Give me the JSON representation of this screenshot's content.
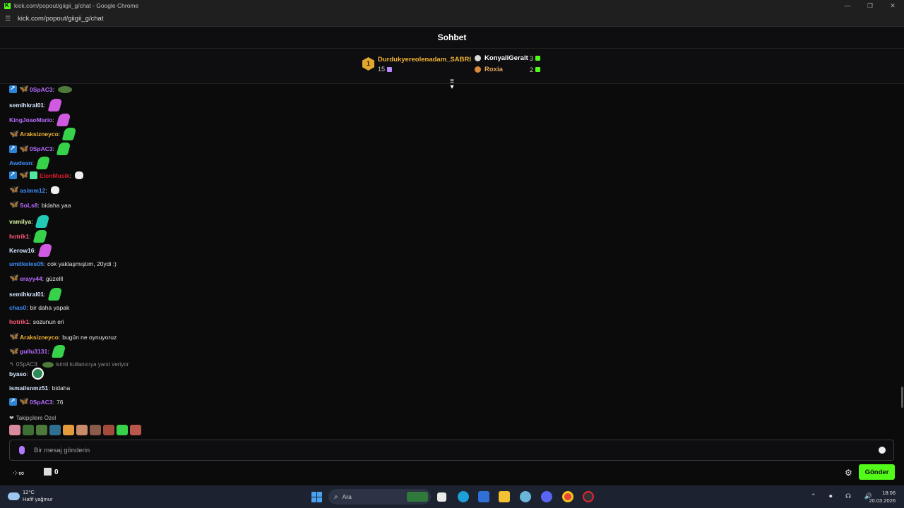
{
  "window": {
    "title": "kick.com/popout/giigii_g/chat - Google Chrome",
    "url": "kick.com/popout/giigii_g/chat"
  },
  "chat_header": {
    "title": "Sohbet"
  },
  "leaderboard": {
    "first": {
      "rank": "1",
      "name": "Durdukyereolenadam_SABRI",
      "count": "15"
    },
    "second": {
      "name": "KonyaliGeralt",
      "count": "3"
    },
    "third": {
      "name": "Roxia",
      "count": "2"
    }
  },
  "messages": [
    {
      "user": "0SpAC3",
      "color": "#b86bff",
      "text": ""
    },
    {
      "user": "semihkral01",
      "color": "#d6e7ff",
      "text": ""
    },
    {
      "user": "KingJoaoMario",
      "color": "#b86bff",
      "text": ""
    },
    {
      "user": "Araksizneyco",
      "color": "#f2b434",
      "text": ""
    },
    {
      "user": "0SpAC3",
      "color": "#b86bff",
      "text": ""
    },
    {
      "user": "Awdean",
      "color": "#3d8cf5",
      "text": ""
    },
    {
      "user": "ElonMusik",
      "color": "#e0182b",
      "text": ""
    },
    {
      "user": "asimm12",
      "color": "#3d8cf5",
      "text": ""
    },
    {
      "user": "SoLs8",
      "color": "#b86bff",
      "text": "bidaha yaa"
    },
    {
      "user": "vamilya",
      "color": "#d8f5a2",
      "text": ""
    },
    {
      "user": "hotrik1",
      "color": "#ff5a7a",
      "text": ""
    },
    {
      "user": "Kerow16",
      "color": "#d6e7ff",
      "text": ""
    },
    {
      "user": "umitkeles05",
      "color": "#3d8cf5",
      "text": "cok yaklaşmıştım, 20ydi :)"
    },
    {
      "user": "erayy44",
      "color": "#b86bff",
      "text": "güzelll"
    },
    {
      "user": "semihkral01",
      "color": "#d6e7ff",
      "text": ""
    },
    {
      "user": "chas0",
      "color": "#3d8cf5",
      "text": "bir daha yapak"
    },
    {
      "user": "hotrik1",
      "color": "#ff5a7a",
      "text": "sozunun eri"
    },
    {
      "user": "Araksizneyco",
      "color": "#f2b434",
      "text": "bugün ne oynuyoruz"
    },
    {
      "user": "gullu3131",
      "color": "#b86bff",
      "text": ""
    },
    {
      "user": "byaso",
      "color": "#d6e7ff",
      "text": ""
    },
    {
      "user": "ismailsnmz51",
      "color": "#d6e7ff",
      "text": "bidaha"
    },
    {
      "user": "0SpAC3",
      "color": "#b86bff",
      "text": "76"
    }
  ],
  "reply": {
    "user": "0SpAC3:",
    "text": "isimli kullanıcıya yanıt veriyor"
  },
  "followers_only": {
    "label": "Takipçilere Özel"
  },
  "input": {
    "placeholder": "Bir mesaj gönderin"
  },
  "bottom": {
    "store_count": "0",
    "send_label": "Gönder"
  },
  "taskbar": {
    "weather_temp": "12°C",
    "weather_desc": "Hafif yağmur",
    "search_placeholder": "Ara",
    "time": "18:06",
    "date": "20.03.2026"
  },
  "colors": {
    "accent": "#53fc18",
    "gold": "#f2b434",
    "background": "#0b0b0c"
  }
}
